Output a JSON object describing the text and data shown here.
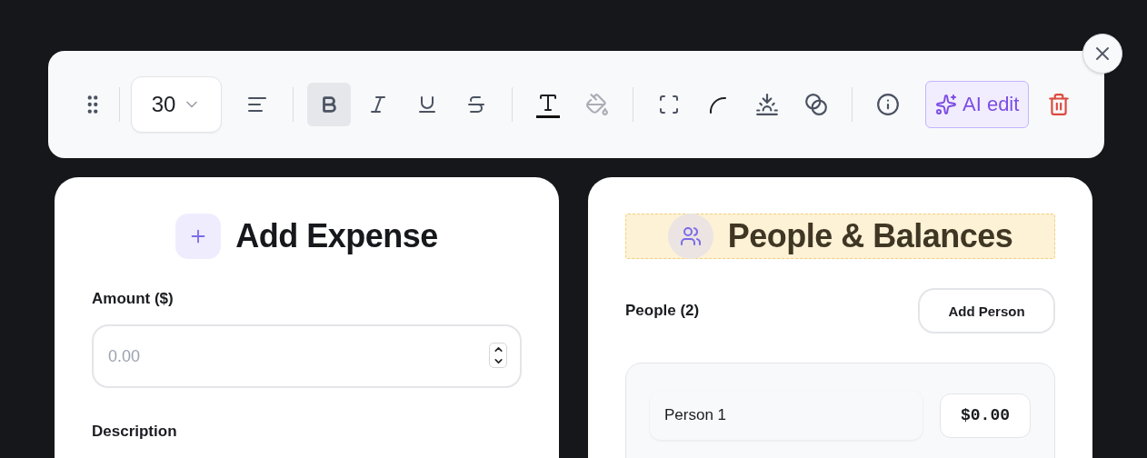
{
  "toolbar": {
    "font_size": "30",
    "groups": [
      [
        {
          "kind": "align",
          "selected": false,
          "disabled": false
        }
      ],
      [
        {
          "kind": "bold",
          "selected": true,
          "disabled": false
        },
        {
          "kind": "italic",
          "selected": false,
          "disabled": false
        },
        {
          "kind": "underline",
          "selected": false,
          "disabled": false
        },
        {
          "kind": "strike",
          "selected": false,
          "disabled": false
        }
      ],
      [
        {
          "kind": "text-color",
          "selected": false,
          "disabled": false
        },
        {
          "kind": "fill",
          "selected": false,
          "disabled": true
        }
      ],
      [
        {
          "kind": "frame",
          "selected": false,
          "disabled": false
        },
        {
          "kind": "corner",
          "selected": false,
          "disabled": false
        },
        {
          "kind": "shadow",
          "selected": false,
          "disabled": false
        },
        {
          "kind": "blend",
          "selected": false,
          "disabled": false
        }
      ],
      [
        {
          "kind": "info",
          "selected": false,
          "disabled": false
        },
        {
          "kind": "ai",
          "selected": false,
          "disabled": false
        },
        {
          "kind": "delete",
          "selected": false,
          "disabled": false
        }
      ]
    ],
    "ai_label": "AI edit"
  },
  "expense_panel": {
    "title": "Add Expense",
    "amount_label": "Amount ($)",
    "amount_placeholder": "0.00",
    "description_label": "Description"
  },
  "people_panel": {
    "title": "People & Balances",
    "title_highlighted": true,
    "people_label": "People (2)",
    "add_button": "Add Person",
    "people": [
      {
        "name": "Person 1",
        "balance": "$0.00"
      }
    ]
  }
}
